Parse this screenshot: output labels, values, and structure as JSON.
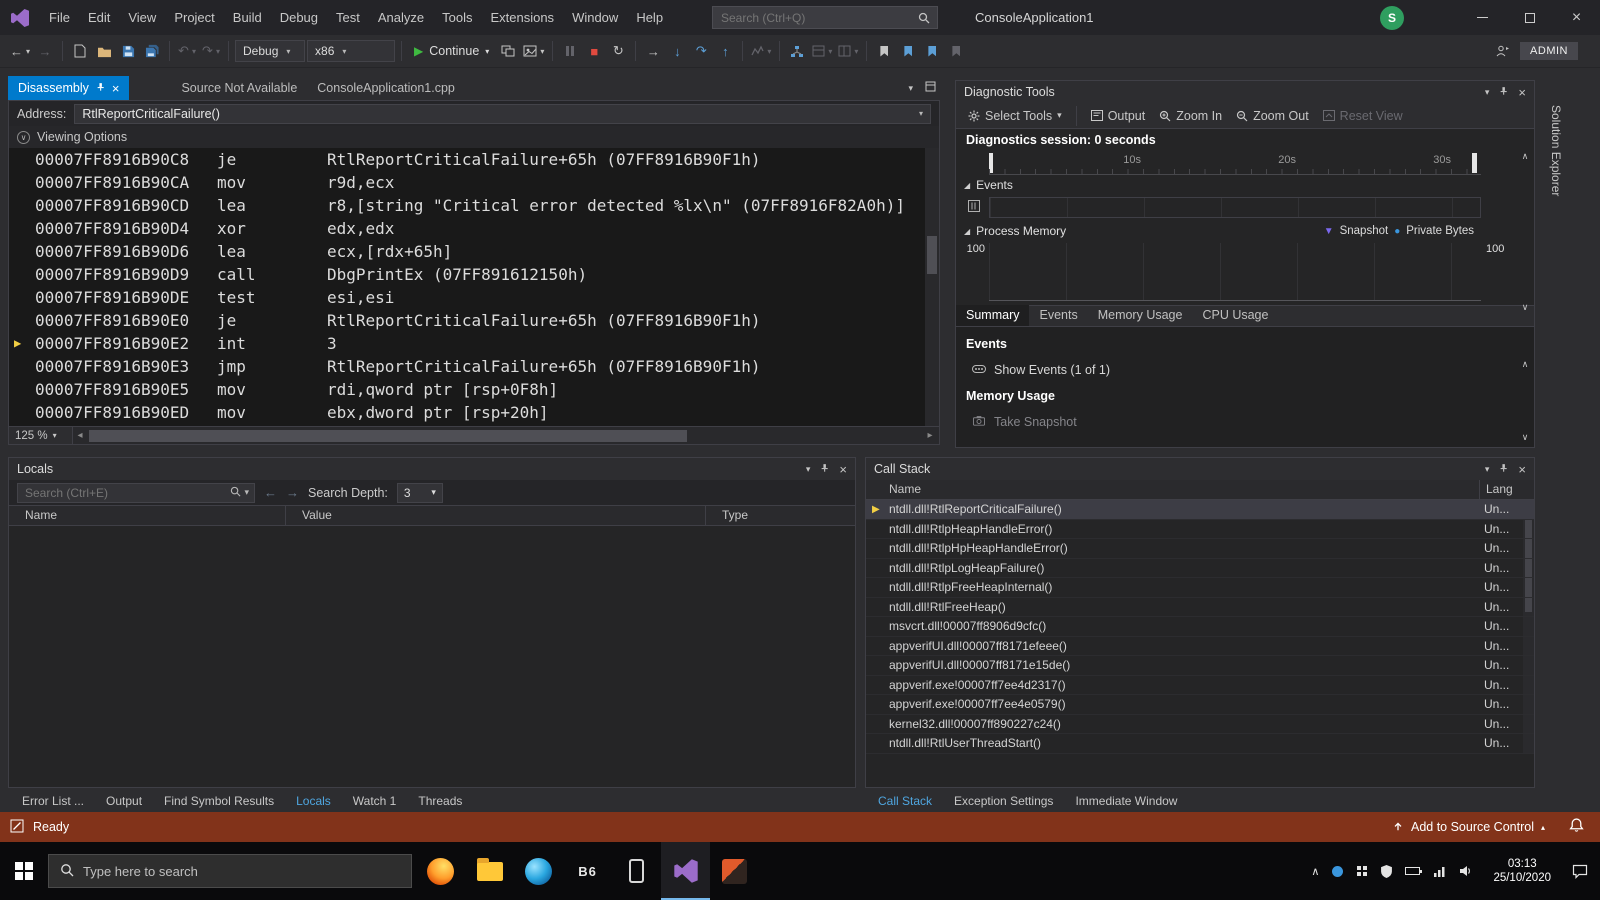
{
  "colors": {
    "accent_blue": "#007acc",
    "status_bar_debug": "#82331a",
    "current_statement_arrow": "#f2cf44",
    "legend_snapshot_color": "#7b68ee",
    "legend_private_bytes_color": "#3a96dd",
    "continue_green": "#3fba41",
    "stop_red": "#e04a3f"
  },
  "icons": {
    "caret_down": "▾",
    "caret_up": "▴",
    "play": "▶",
    "stop": "■",
    "restart": "↻",
    "arrow_left": "←",
    "arrow_right": "→",
    "arrow_up": "↑",
    "arrow_down": "↓",
    "undo": "↶",
    "redo": "↷",
    "close": "×",
    "chevron_up": "∧",
    "chevron_down": "∨",
    "expander_open": "◢",
    "legend_triangle": "▼",
    "legend_circle": "●",
    "current_arrow": "▶",
    "scroll_left": "◂",
    "scroll_right": "▸",
    "up_triangle": "▲"
  },
  "title_bar": {
    "menus": [
      "File",
      "Edit",
      "View",
      "Project",
      "Build",
      "Debug",
      "Test",
      "Analyze",
      "Tools",
      "Extensions",
      "Window",
      "Help"
    ],
    "search_placeholder": "Search (Ctrl+Q)",
    "window_title": "ConsoleApplication1",
    "avatar_initial": "S"
  },
  "toolbar": {
    "configuration": "Debug",
    "platform": "x86",
    "continue_label": "Continue",
    "admin_label": "ADMIN"
  },
  "editor": {
    "tabs": [
      {
        "label": "Disassembly",
        "active": true
      },
      {
        "label": "Source Not Available",
        "active": false
      },
      {
        "label": "ConsoleApplication1.cpp",
        "active": false
      }
    ],
    "address_label": "Address:",
    "address_value": "RtlReportCriticalFailure()",
    "viewing_options_label": "Viewing Options",
    "zoom_level": "125 %",
    "disassembly_lines": [
      {
        "address": "00007FF8916B90C8",
        "opcode": "je",
        "operands": "RtlReportCriticalFailure+65h (07FF8916B90F1h)",
        "current": false
      },
      {
        "address": "00007FF8916B90CA",
        "opcode": "mov",
        "operands": "r9d,ecx",
        "current": false
      },
      {
        "address": "00007FF8916B90CD",
        "opcode": "lea",
        "operands": "r8,[string \"Critical error detected %lx\\n\" (07FF8916F82A0h)]",
        "current": false
      },
      {
        "address": "00007FF8916B90D4",
        "opcode": "xor",
        "operands": "edx,edx",
        "current": false
      },
      {
        "address": "00007FF8916B90D6",
        "opcode": "lea",
        "operands": "ecx,[rdx+65h]",
        "current": false
      },
      {
        "address": "00007FF8916B90D9",
        "opcode": "call",
        "operands": "DbgPrintEx (07FF891612150h)",
        "current": false
      },
      {
        "address": "00007FF8916B90DE",
        "opcode": "test",
        "operands": "esi,esi",
        "current": false
      },
      {
        "address": "00007FF8916B90E0",
        "opcode": "je",
        "operands": "RtlReportCriticalFailure+65h (07FF8916B90F1h)",
        "current": false
      },
      {
        "address": "00007FF8916B90E2",
        "opcode": "int",
        "operands": "3",
        "current": true
      },
      {
        "address": "00007FF8916B90E3",
        "opcode": "jmp",
        "operands": "RtlReportCriticalFailure+65h (07FF8916B90F1h)",
        "current": false
      },
      {
        "address": "00007FF8916B90E5",
        "opcode": "mov",
        "operands": "rdi,qword ptr [rsp+0F8h]",
        "current": false
      },
      {
        "address": "00007FF8916B90ED",
        "opcode": "mov",
        "operands": "ebx,dword ptr [rsp+20h]",
        "current": false
      }
    ]
  },
  "diagnostic_tools": {
    "title": "Diagnostic Tools",
    "toolbar": {
      "select_tools": "Select Tools",
      "output": "Output",
      "zoom_in": "Zoom In",
      "zoom_out": "Zoom Out",
      "reset_view": "Reset View"
    },
    "session_label": "Diagnostics session: 0 seconds",
    "timeline_ticks": [
      "10s",
      "20s",
      "30s"
    ],
    "events_section_label": "Events",
    "process_memory_section_label": "Process Memory",
    "legend": {
      "snapshot": "Snapshot",
      "private_bytes": "Private Bytes"
    },
    "memory_axis_max_left": "100",
    "memory_axis_max_right": "100",
    "tabs": [
      {
        "label": "Summary",
        "active": true
      },
      {
        "label": "Events",
        "active": false
      },
      {
        "label": "Memory Usage",
        "active": false
      },
      {
        "label": "CPU Usage",
        "active": false
      }
    ],
    "summary": {
      "events_heading": "Events",
      "show_events_label": "Show Events (1 of 1)",
      "memory_usage_heading": "Memory Usage",
      "take_snapshot_label": "Take Snapshot"
    }
  },
  "locals": {
    "title": "Locals",
    "search_placeholder": "Search (Ctrl+E)",
    "search_depth_label": "Search Depth:",
    "search_depth_value": "3",
    "columns": [
      "Name",
      "Value",
      "Type"
    ]
  },
  "left_dock_tabs": [
    {
      "label": "Error List ...",
      "active": false
    },
    {
      "label": "Output",
      "active": false
    },
    {
      "label": "Find Symbol Results",
      "active": false
    },
    {
      "label": "Locals",
      "active": true
    },
    {
      "label": "Watch 1",
      "active": false
    },
    {
      "label": "Threads",
      "active": false
    }
  ],
  "call_stack": {
    "title": "Call Stack",
    "name_column": "Name",
    "lang_column": "Lang",
    "frames": [
      {
        "name": "ntdll.dll!RtlReportCriticalFailure()",
        "lang": "Un...",
        "current": true
      },
      {
        "name": "ntdll.dll!RtlpHeapHandleError()",
        "lang": "Un...",
        "current": false
      },
      {
        "name": "ntdll.dll!RtlpHpHeapHandleError()",
        "lang": "Un...",
        "current": false
      },
      {
        "name": "ntdll.dll!RtlpLogHeapFailure()",
        "lang": "Un...",
        "current": false
      },
      {
        "name": "ntdll.dll!RtlpFreeHeapInternal()",
        "lang": "Un...",
        "current": false
      },
      {
        "name": "ntdll.dll!RtlFreeHeap()",
        "lang": "Un...",
        "current": false
      },
      {
        "name": "msvcrt.dll!00007ff8906d9cfc()",
        "lang": "Un...",
        "current": false
      },
      {
        "name": "appverifUI.dll!00007ff8171efeee()",
        "lang": "Un...",
        "current": false
      },
      {
        "name": "appverifUI.dll!00007ff8171e15de()",
        "lang": "Un...",
        "current": false
      },
      {
        "name": "appverif.exe!00007ff7ee4d2317()",
        "lang": "Un...",
        "current": false
      },
      {
        "name": "appverif.exe!00007ff7ee4e0579()",
        "lang": "Un...",
        "current": false
      },
      {
        "name": "kernel32.dll!00007ff890227c24()",
        "lang": "Un...",
        "current": false
      },
      {
        "name": "ntdll.dll!RtlUserThreadStart()",
        "lang": "Un...",
        "current": false
      }
    ]
  },
  "right_dock_tabs": [
    {
      "label": "Call Stack",
      "active": true
    },
    {
      "label": "Exception Settings",
      "active": false
    },
    {
      "label": "Immediate Window",
      "active": false
    }
  ],
  "solution_explorer_tab": "Solution Explorer",
  "status_bar": {
    "ready_label": "Ready",
    "source_control_label": "Add to Source Control"
  },
  "taskbar": {
    "search_placeholder": "Type here to search",
    "b6_label": "B6",
    "clock_time": "03:13",
    "clock_date": "25/10/2020"
  }
}
